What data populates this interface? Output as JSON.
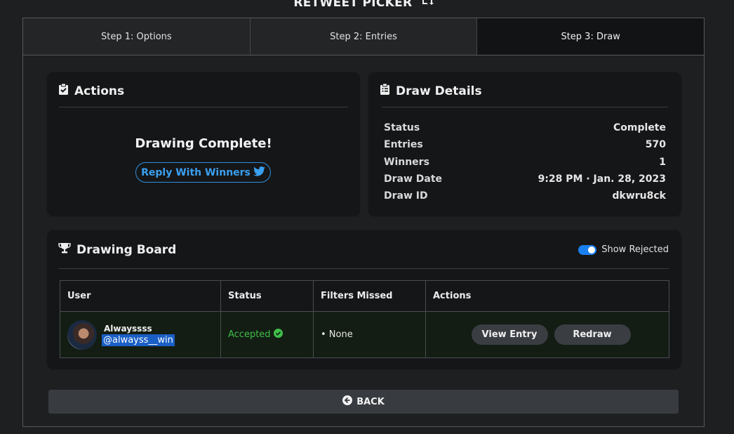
{
  "app": {
    "title": "RETWEET PICKER",
    "title_icon": "retweet-icon"
  },
  "tabs": [
    {
      "label": "Step 1: Options",
      "active": false
    },
    {
      "label": "Step 2: Entries",
      "active": false
    },
    {
      "label": "Step 3: Draw",
      "active": true
    }
  ],
  "actions": {
    "title": "Actions",
    "icon": "clipboard-check-icon",
    "message": "Drawing Complete!",
    "reply_button": "Reply With Winners"
  },
  "details": {
    "title": "Draw Details",
    "icon": "clipboard-list-icon",
    "rows": [
      {
        "label": "Status",
        "value": "Complete"
      },
      {
        "label": "Entries",
        "value": "570"
      },
      {
        "label": "Winners",
        "value": "1"
      },
      {
        "label": "Draw Date",
        "value": "9:28 PM · Jan. 28, 2023"
      },
      {
        "label": "Draw ID",
        "value": "dkwru8ck"
      }
    ]
  },
  "board": {
    "title": "Drawing Board",
    "icon": "trophy-icon",
    "toggle_label": "Show Rejected",
    "toggle_on": true,
    "columns": [
      "User",
      "Status",
      "Filters Missed",
      "Actions"
    ],
    "rows": [
      {
        "display_name": "Alwayssss",
        "handle": "@alwayss__win",
        "status": "Accepted",
        "filters_missed": "• None",
        "view_label": "View Entry",
        "redraw_label": "Redraw"
      }
    ]
  },
  "back_button": "BACK",
  "colors": {
    "accent": "#1a7ff0",
    "link": "#3a9ff0",
    "success": "#3fbf4a"
  }
}
